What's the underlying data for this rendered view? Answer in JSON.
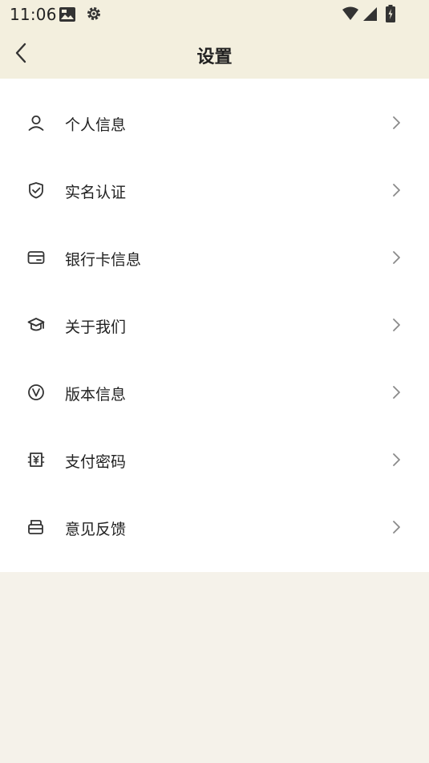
{
  "status_bar": {
    "time": "11:06",
    "icons": [
      "photo-icon",
      "settings-gear-icon",
      "wifi-icon",
      "signal-icon",
      "battery-charging-icon"
    ]
  },
  "nav": {
    "title": "设置",
    "back_icon": "back-arrow-icon"
  },
  "menu": {
    "items": [
      {
        "label": "个人信息",
        "icon": "person-icon"
      },
      {
        "label": "实名认证",
        "icon": "shield-check-icon"
      },
      {
        "label": "银行卡信息",
        "icon": "card-icon"
      },
      {
        "label": "关于我们",
        "icon": "graduation-cap-icon"
      },
      {
        "label": "版本信息",
        "icon": "version-icon"
      },
      {
        "label": "支付密码",
        "icon": "yen-payment-icon"
      },
      {
        "label": "意见反馈",
        "icon": "feedback-icon"
      }
    ]
  },
  "colors": {
    "header_bg": "#f3efde",
    "page_bg": "#f5f2ea",
    "card_bg": "#ffffff",
    "text": "#222222",
    "chevron": "#8a8a8a"
  }
}
